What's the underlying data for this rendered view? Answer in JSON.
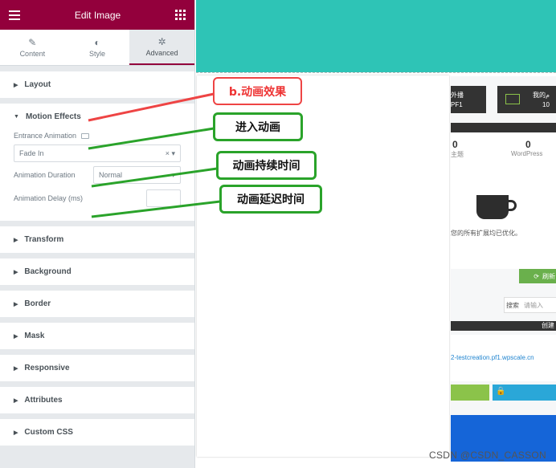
{
  "panel": {
    "title": "Edit Image",
    "tabs": [
      {
        "label": "Content",
        "icon": "pencil-icon"
      },
      {
        "label": "Style",
        "icon": "half-circle-icon"
      },
      {
        "label": "Advanced",
        "icon": "gear-icon"
      }
    ],
    "sections": {
      "layout": "Layout",
      "motion": "Motion Effects",
      "transform": "Transform",
      "background": "Background",
      "border": "Border",
      "mask": "Mask",
      "responsive": "Responsive",
      "attributes": "Attributes",
      "custom_css": "Custom CSS"
    },
    "entrance": {
      "label": "Entrance Animation",
      "value": "Fade In"
    },
    "duration": {
      "label": "Animation Duration",
      "value": "Normal"
    },
    "delay": {
      "label": "Animation Delay (ms)",
      "value": ""
    }
  },
  "site": {
    "btn1_line1": "外播",
    "btn1_line2": "PF1",
    "btn2_line1": "我的م",
    "btn2_line2": "10",
    "stat1_value": "0",
    "stat1_label": "主题",
    "stat2_value": "0",
    "stat2_label": "WordPress",
    "msg": "您的所有扩展均已优化。",
    "refresh_btn": "刷新",
    "search_label": "搜索",
    "search_placeholder": "请输入",
    "bar_text": "创建",
    "url": "2-testcreation.pf1.wpscale.cn"
  },
  "annotations": {
    "a1": "b.动画效果",
    "a2": "进入动画",
    "a3": "动画持续时间",
    "a4": "动画延迟时间"
  },
  "watermark": "CSDN @CSDN_CASSON",
  "colors": {
    "brand": "#93003c",
    "teal": "#2ec4b6",
    "annot_red": "#ee4444",
    "annot_green": "#2aa32a",
    "site_green": "#6ab04c",
    "site_blue": "#2185d0"
  }
}
